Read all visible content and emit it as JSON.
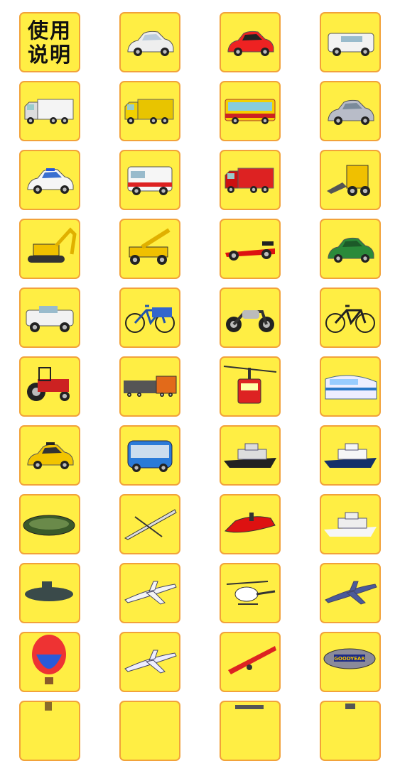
{
  "colors": {
    "tile_bg": "#FFEE44",
    "tile_border": "#F2A23A",
    "page_bg": "#FFFFFF"
  },
  "help_tile": {
    "line1": "使用",
    "line2": "说明"
  },
  "tiles": [
    "help-instructions",
    "white-sports-car",
    "red-convertible-car",
    "white-suv",
    "white-semi-truck",
    "yellow-vintage-truck",
    "red-yellow-city-bus",
    "silver-minivan",
    "police-car",
    "ambulance-van",
    "red-fire-truck",
    "yellow-skid-steer-loader",
    "yellow-excavator",
    "yellow-mobile-crane",
    "red-formula-race-car",
    "green-vintage-roadster",
    "white-pickup-truck",
    "blue-cargo-tricycle",
    "motorcycle",
    "bicycle",
    "red-tractor",
    "freight-train",
    "red-cable-car",
    "high-speed-train",
    "yellow-taxi",
    "blue-tourist-tram",
    "cargo-ship",
    "cruise-ship",
    "green-inflatable-boat",
    "kayak",
    "red-jet-ski",
    "white-yacht",
    "submarine",
    "passenger-airplane",
    "helicopter",
    "fighter-jet",
    "hot-air-balloon",
    "propeller-airplane",
    "red-ultralight-plane",
    "goodyear-blimp",
    "bottom-row-partial-1",
    "bottom-row-partial-2",
    "bottom-row-partial-3",
    "bottom-row-partial-4"
  ],
  "blimp_text": "GOODYEAR"
}
